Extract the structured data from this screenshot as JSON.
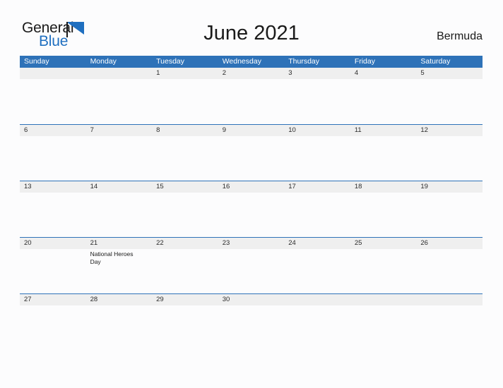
{
  "brand": {
    "name_part1": "General",
    "name_part2": "Blue",
    "flag_icon": "blue-triangle-flag-icon",
    "primary_color": "#2e72b8",
    "text_color": "#1a1a1a"
  },
  "header": {
    "title": "June 2021",
    "region": "Bermuda"
  },
  "calendar": {
    "weekdays": [
      "Sunday",
      "Monday",
      "Tuesday",
      "Wednesday",
      "Thursday",
      "Friday",
      "Saturday"
    ],
    "header_bg": "#2e72b8",
    "header_text": "#ffffff",
    "day_band_bg": "#efefef",
    "row_border": "#2e72b8",
    "weeks": [
      [
        {
          "day": "",
          "events": []
        },
        {
          "day": "",
          "events": []
        },
        {
          "day": "1",
          "events": []
        },
        {
          "day": "2",
          "events": []
        },
        {
          "day": "3",
          "events": []
        },
        {
          "day": "4",
          "events": []
        },
        {
          "day": "5",
          "events": []
        }
      ],
      [
        {
          "day": "6",
          "events": []
        },
        {
          "day": "7",
          "events": []
        },
        {
          "day": "8",
          "events": []
        },
        {
          "day": "9",
          "events": []
        },
        {
          "day": "10",
          "events": []
        },
        {
          "day": "11",
          "events": []
        },
        {
          "day": "12",
          "events": []
        }
      ],
      [
        {
          "day": "13",
          "events": []
        },
        {
          "day": "14",
          "events": []
        },
        {
          "day": "15",
          "events": []
        },
        {
          "day": "16",
          "events": []
        },
        {
          "day": "17",
          "events": []
        },
        {
          "day": "18",
          "events": []
        },
        {
          "day": "19",
          "events": []
        }
      ],
      [
        {
          "day": "20",
          "events": []
        },
        {
          "day": "21",
          "events": [
            "National Heroes",
            "Day"
          ]
        },
        {
          "day": "22",
          "events": []
        },
        {
          "day": "23",
          "events": []
        },
        {
          "day": "24",
          "events": []
        },
        {
          "day": "25",
          "events": []
        },
        {
          "day": "26",
          "events": []
        }
      ],
      [
        {
          "day": "27",
          "events": []
        },
        {
          "day": "28",
          "events": []
        },
        {
          "day": "29",
          "events": []
        },
        {
          "day": "30",
          "events": []
        },
        {
          "day": "",
          "events": []
        },
        {
          "day": "",
          "events": []
        },
        {
          "day": "",
          "events": []
        }
      ]
    ]
  }
}
